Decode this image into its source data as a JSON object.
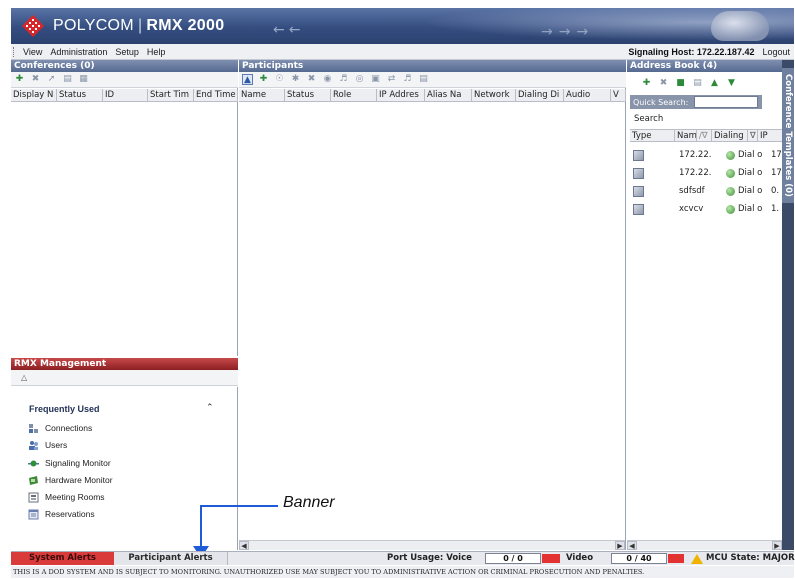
{
  "header": {
    "brand": "POLYCOM",
    "product": "RMX 2000"
  },
  "menu": {
    "items": [
      "View",
      "Administration",
      "Setup",
      "Help"
    ],
    "signaling_host": "Signaling Host: 172.22.187.42",
    "logout": "Logout"
  },
  "conferences": {
    "title": "Conferences (0)",
    "columns": [
      "Display N",
      "Status",
      "ID",
      "Start Tim",
      "End Time"
    ]
  },
  "participants": {
    "title": "Participants",
    "columns": [
      "Name",
      "Status",
      "Role",
      "IP Addres",
      "Alias Na",
      "Network",
      "Dialing Di",
      "Audio",
      "V"
    ]
  },
  "address_book": {
    "title": "Address Book (4)",
    "quick_search_label": "Quick Search:",
    "quick_search_value": "",
    "search_label": "Search",
    "columns": [
      "Type",
      "Nam",
      "Dialing",
      "IP"
    ],
    "rows": [
      {
        "name": "172.22.",
        "dialing": "Dial o",
        "ip": "17"
      },
      {
        "name": "172.22.",
        "dialing": "Dial o",
        "ip": "17"
      },
      {
        "name": "sdfsdf",
        "dialing": "Dial o",
        "ip": "0."
      },
      {
        "name": "xcvcv",
        "dialing": "Dial o",
        "ip": "1."
      }
    ],
    "side_tab": "Conference Templates (0)"
  },
  "rmx_management": {
    "title": "RMX Management",
    "section": "Frequently Used",
    "items": [
      "Connections",
      "Users",
      "Signaling Monitor",
      "Hardware Monitor",
      "Meeting Rooms",
      "Reservations"
    ]
  },
  "annotation": {
    "banner": "Banner"
  },
  "statusbar": {
    "system_alerts": "System Alerts",
    "participant_alerts": "Participant Alerts",
    "port_usage_label": "Port Usage:",
    "voice_label": "Voice",
    "voice_value": "0 / 0",
    "video_label": "Video",
    "video_value": "0 / 40",
    "mcu_state": "MCU State: MAJOR"
  },
  "legal_banner": "THIS IS A DOD SYSTEM AND IS SUBJECT TO MONITORING. UNAUTHORIZED USE MAY SUBJECT YOU TO ADMINISTRATIVE ACTION OR CRIMINAL PROSECUTION AND PENALTIES.",
  "colors": {
    "header": "#344d80",
    "alert_red": "#d93a3a",
    "annotation_blue": "#1e5bd8",
    "pane_title": "#55698f"
  }
}
